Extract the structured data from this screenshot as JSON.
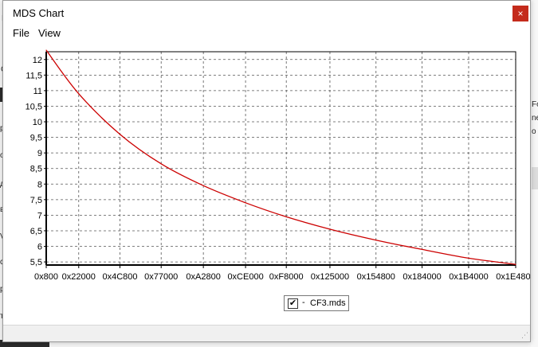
{
  "window": {
    "title": "MDS Chart",
    "close_glyph": "×"
  },
  "menu": {
    "items": [
      "File",
      "View"
    ]
  },
  "background_fragments": [
    "In",
    "Co",
    "Fo",
    "ne",
    "o I",
    "ра",
    "ое",
    "д",
    "в",
    "VD",
    "ск",
    "ра",
    "те"
  ],
  "chart_data": {
    "type": "line",
    "x_tick_labels": [
      "0x800",
      "0x22000",
      "0x4C800",
      "0x77000",
      "0xA2800",
      "0xCE000",
      "0xF8000",
      "0x125000",
      "0x154800",
      "0x184000",
      "0x1B4000",
      "0x1E4800"
    ],
    "x_ticks": [
      2048,
      139264,
      313344,
      487424,
      665600,
      843776,
      1015808,
      1200128,
      1394688,
      1589248,
      1785856,
      1984512
    ],
    "y_tick_labels": [
      "12",
      "11,5",
      "11",
      "10,5",
      "10",
      "9,5",
      "9",
      "8,5",
      "8",
      "7,5",
      "7",
      "6,5",
      "6",
      "5,5"
    ],
    "y_ticks": [
      12,
      11.5,
      11,
      10.5,
      10,
      9.5,
      9,
      8.5,
      8,
      7.5,
      7,
      6.5,
      6,
      5.5
    ],
    "xlim": [
      2048,
      1984512
    ],
    "ylim": [
      5.4,
      12.25
    ],
    "grid": true,
    "legend_placement": "bottom-center",
    "series": [
      {
        "name": "CF3.mds",
        "color": "#cc0000",
        "x": [
          2048,
          139264,
          313344,
          487424,
          665600,
          843776,
          1015808,
          1200128,
          1394688,
          1589248,
          1785856,
          1984512
        ],
        "y": [
          12.3,
          10.9,
          9.6,
          8.65,
          7.95,
          7.4,
          6.95,
          6.55,
          6.2,
          5.9,
          5.62,
          5.42
        ]
      }
    ]
  },
  "legend": {
    "dash": "-",
    "checked_glyph": "✔"
  }
}
